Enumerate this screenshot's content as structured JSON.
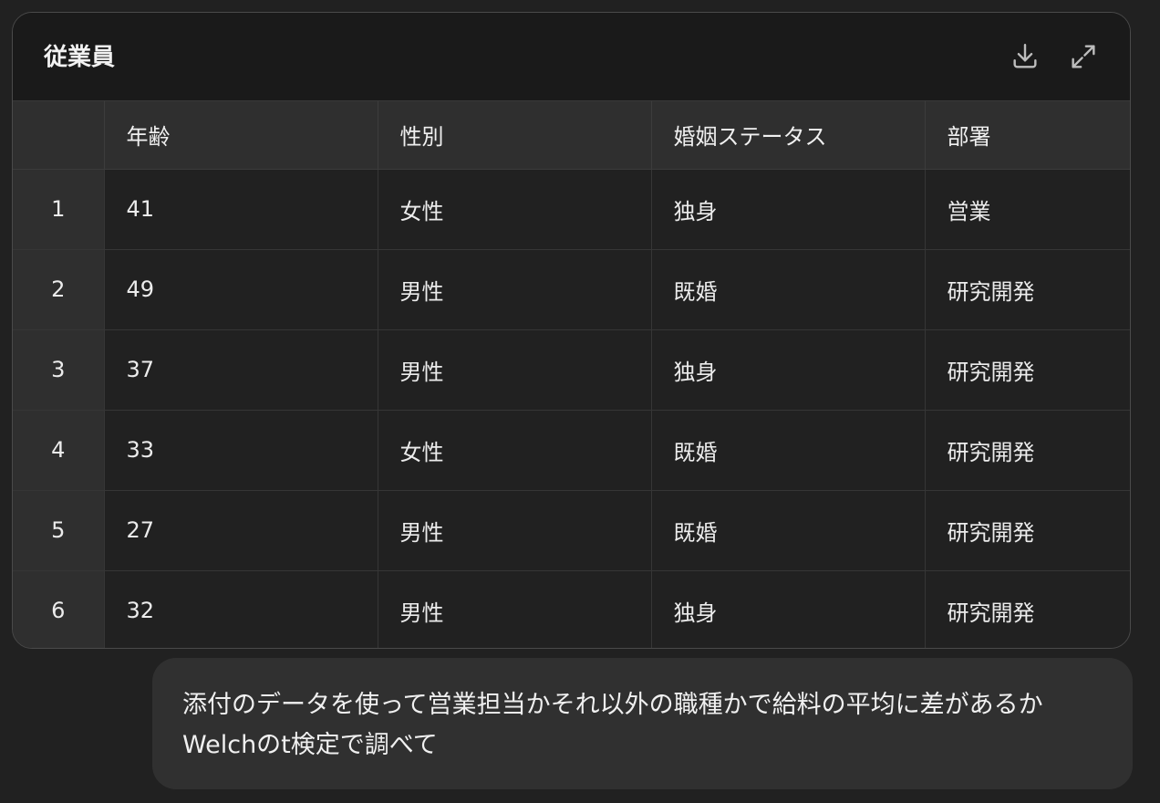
{
  "table_card": {
    "title": "従業員",
    "download_icon": "download-icon",
    "expand_icon": "expand-icon",
    "columns": [
      "",
      "年齢",
      "性別",
      "婚姻ステータス",
      "部署"
    ],
    "rows": [
      {
        "index": "1",
        "age": "41",
        "gender": "女性",
        "marital": "独身",
        "dept": "営業"
      },
      {
        "index": "2",
        "age": "49",
        "gender": "男性",
        "marital": "既婚",
        "dept": "研究開発"
      },
      {
        "index": "3",
        "age": "37",
        "gender": "男性",
        "marital": "独身",
        "dept": "研究開発"
      },
      {
        "index": "4",
        "age": "33",
        "gender": "女性",
        "marital": "既婚",
        "dept": "研究開発"
      },
      {
        "index": "5",
        "age": "27",
        "gender": "男性",
        "marital": "既婚",
        "dept": "研究開発"
      },
      {
        "index": "6",
        "age": "32",
        "gender": "男性",
        "marital": "独身",
        "dept": "研究開発"
      }
    ]
  },
  "user_message": {
    "text": "添付のデータを使って営業担当かそれ以外の職種かで給料の平均に差があるかWelchのt検定で調べて"
  }
}
